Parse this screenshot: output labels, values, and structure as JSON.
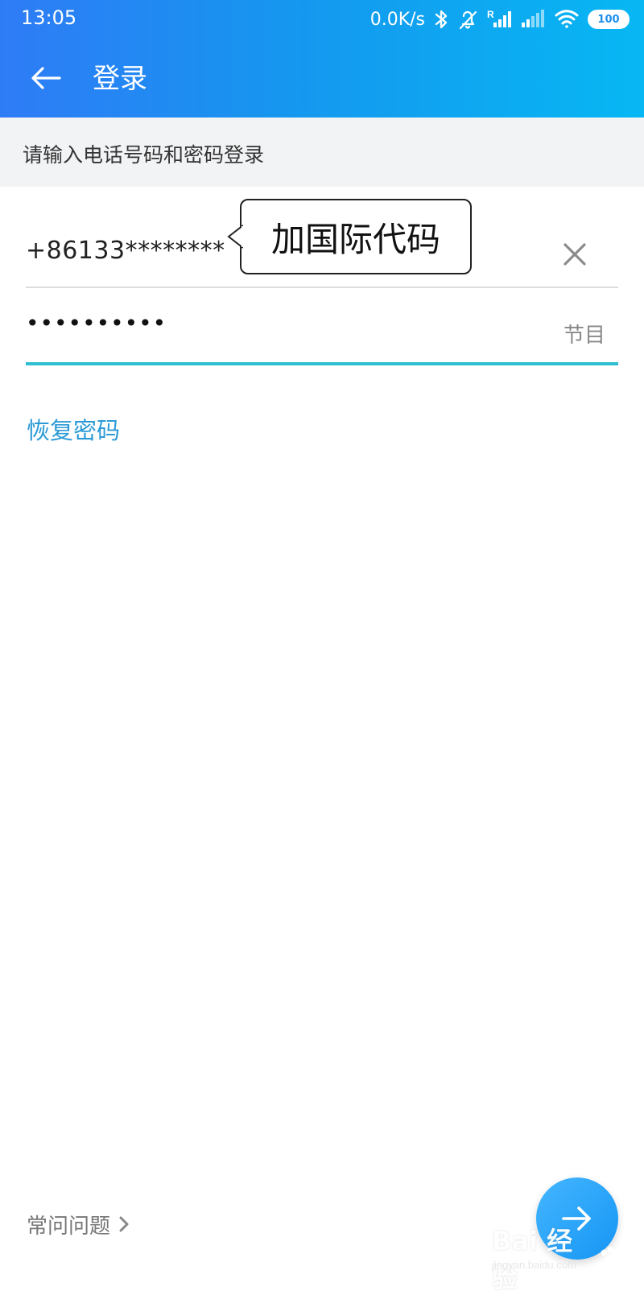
{
  "status_bar": {
    "time": "13:05",
    "net_speed": "0.0K/s",
    "battery": "100",
    "icons": [
      "bluetooth-icon",
      "bell-off-icon",
      "signal-roaming-icon",
      "signal-icon",
      "wifi-icon",
      "battery-icon"
    ]
  },
  "toolbar": {
    "title": "登录",
    "back_icon": "arrow-left-icon"
  },
  "hint": {
    "text": "请输入电话号码和密码登录"
  },
  "form": {
    "phone_value": "+86133********",
    "clear_icon": "close-icon",
    "password_value": "••••••••••",
    "password_toggle_label": "节目",
    "recover_password_label": "恢复密码"
  },
  "tooltip": {
    "text": "加国际代码"
  },
  "footer": {
    "faq_label": "常问问题",
    "faq_icon": "chevron-right-icon",
    "next_icon": "arrow-right-icon"
  },
  "watermark": {
    "brand": "Bai 经验",
    "url": "jingyan.baidu.com"
  },
  "colors": {
    "header_start": "#2f7bf6",
    "header_end": "#07b7f3",
    "accent_link": "#2b9ad6",
    "input_focus_line": "#2ebfd2",
    "fab_blue": "#1595f4"
  }
}
